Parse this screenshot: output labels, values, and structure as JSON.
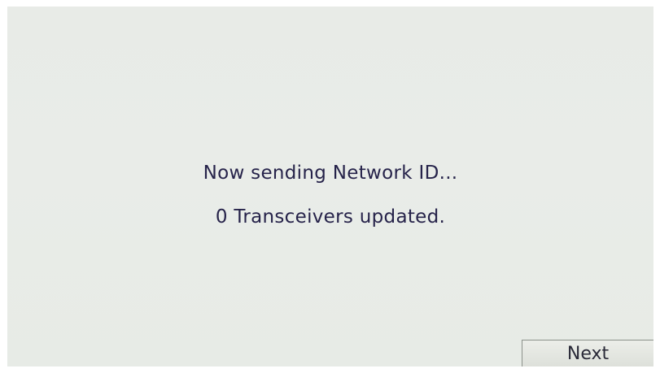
{
  "status": {
    "line1": "Now sending Network ID...",
    "line2": "0 Transceivers updated."
  },
  "buttons": {
    "next_label": "Next"
  },
  "colors": {
    "screen_background": "#e8ebe7",
    "text": "#26234a",
    "button_background": "#dde0da"
  }
}
